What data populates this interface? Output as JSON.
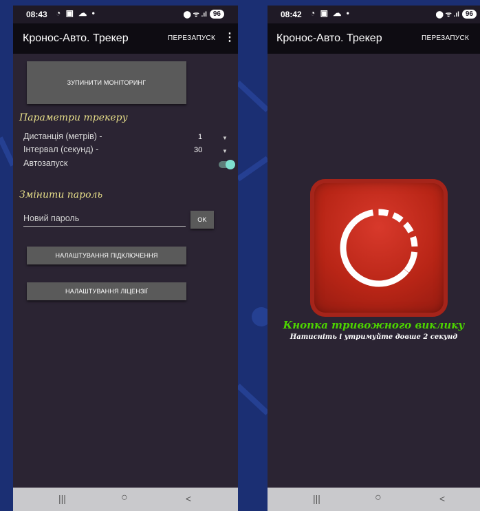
{
  "left_screen": {
    "status": {
      "time": "08:43",
      "icons": "◔ ▣ ☁ •",
      "right_icons": "⬤ ᯤ .ıl",
      "battery": "96"
    },
    "app_title": "Кронос-Авто. Трекер",
    "restart_label": "ПЕРЕЗАПУСК",
    "menu_icon": "⋮",
    "stop_monitoring_label": "ЗУПИНИТИ МОНІТОРИНГ",
    "tracker_params_title": "Параметри трекеру",
    "distance_label": "Дистанція (метрів) -",
    "distance_value": "1",
    "interval_label": "Інтервал (секунд) -",
    "interval_value": "30",
    "autostart_label": "Автозапуск",
    "autostart_on": true,
    "change_password_title": "Змінити пароль",
    "new_password_placeholder": "Новий пароль",
    "ok_label": "OK",
    "connection_settings_label": "НАЛАШТУВАННЯ ПІДКЛЮЧЕННЯ",
    "license_settings_label": "НАЛАШТУВАННЯ ЛІЦЕНЗІЇ"
  },
  "right_screen": {
    "status": {
      "time": "08:42",
      "icons": "◔ ▣ ☁ •",
      "right_icons": "⬤ ᯤ .ıl",
      "battery": "96"
    },
    "app_title": "Кронос-Авто. Трекер",
    "restart_label": "ПЕРЕЗАПУСК",
    "menu_icon": "⋮",
    "alarm_title": "Кнопка тривожного виклику",
    "alarm_subtitle": "Натисніть і утримуйте довше 2 секунд"
  },
  "navbar": {
    "recent": "|||",
    "home": "○",
    "back": "<"
  },
  "colors": {
    "background": "#1b2f73",
    "screen": "#2b2433",
    "section_title": "#e8df8a",
    "alarm_red": "#b82516",
    "alarm_text": "#4cd400",
    "toggle": "#7ee0cf"
  }
}
